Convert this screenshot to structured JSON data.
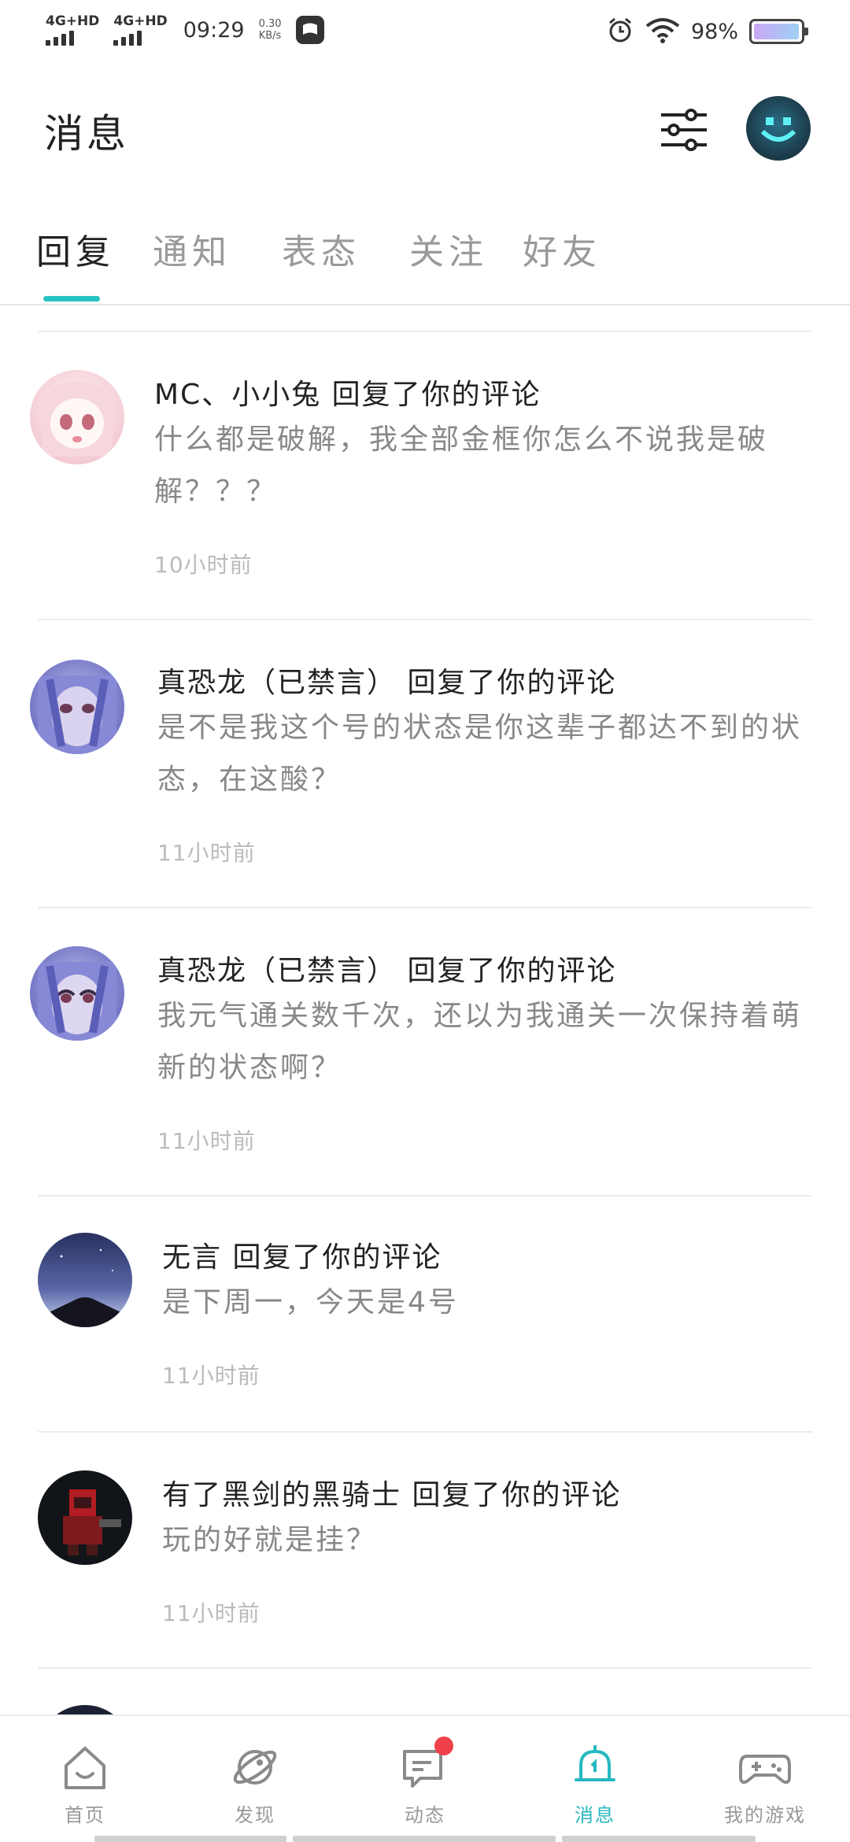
{
  "status_bar": {
    "sim1": "4G+HD",
    "sim2": "4G+HD",
    "time": "09:29",
    "speed_value": "0.30",
    "speed_unit": "KB/s",
    "battery": "98%"
  },
  "header": {
    "title": "消息"
  },
  "tabs": [
    {
      "label": "回复"
    },
    {
      "label": "通知"
    },
    {
      "label": "表态"
    },
    {
      "label": "关注"
    },
    {
      "label": "好友"
    }
  ],
  "messages": [
    {
      "title": "MC、小小兔 回复了你的评论",
      "body": "什么都是破解，我全部金框你怎么不说我是破解？？？",
      "time": "10小时前"
    },
    {
      "title": "真恐龙（已禁言） 回复了你的评论",
      "body": "是不是我这个号的状态是你这辈子都达不到的状态，在这酸？",
      "time": "11小时前"
    },
    {
      "title": "真恐龙（已禁言） 回复了你的评论",
      "body": "我元气通关数千次，还以为我通关一次保持着萌新的状态啊？",
      "time": "11小时前"
    },
    {
      "title": "无言 回复了你的评论",
      "body": "是下周一，今天是4号",
      "time": "11小时前"
    },
    {
      "title": "有了黑剑的黑骑士 回复了你的评论",
      "body": "玩的好就是挂？",
      "time": "11小时前"
    }
  ],
  "bottom_nav": [
    {
      "label": "首页",
      "icon": "home-icon"
    },
    {
      "label": "发现",
      "icon": "planet-icon"
    },
    {
      "label": "动态",
      "icon": "chat-icon"
    },
    {
      "label": "消息",
      "icon": "bell-icon"
    },
    {
      "label": "我的游戏",
      "icon": "gamepad-icon"
    }
  ],
  "colors": {
    "accent": "#27c2c4",
    "badge": "#f0414a"
  }
}
